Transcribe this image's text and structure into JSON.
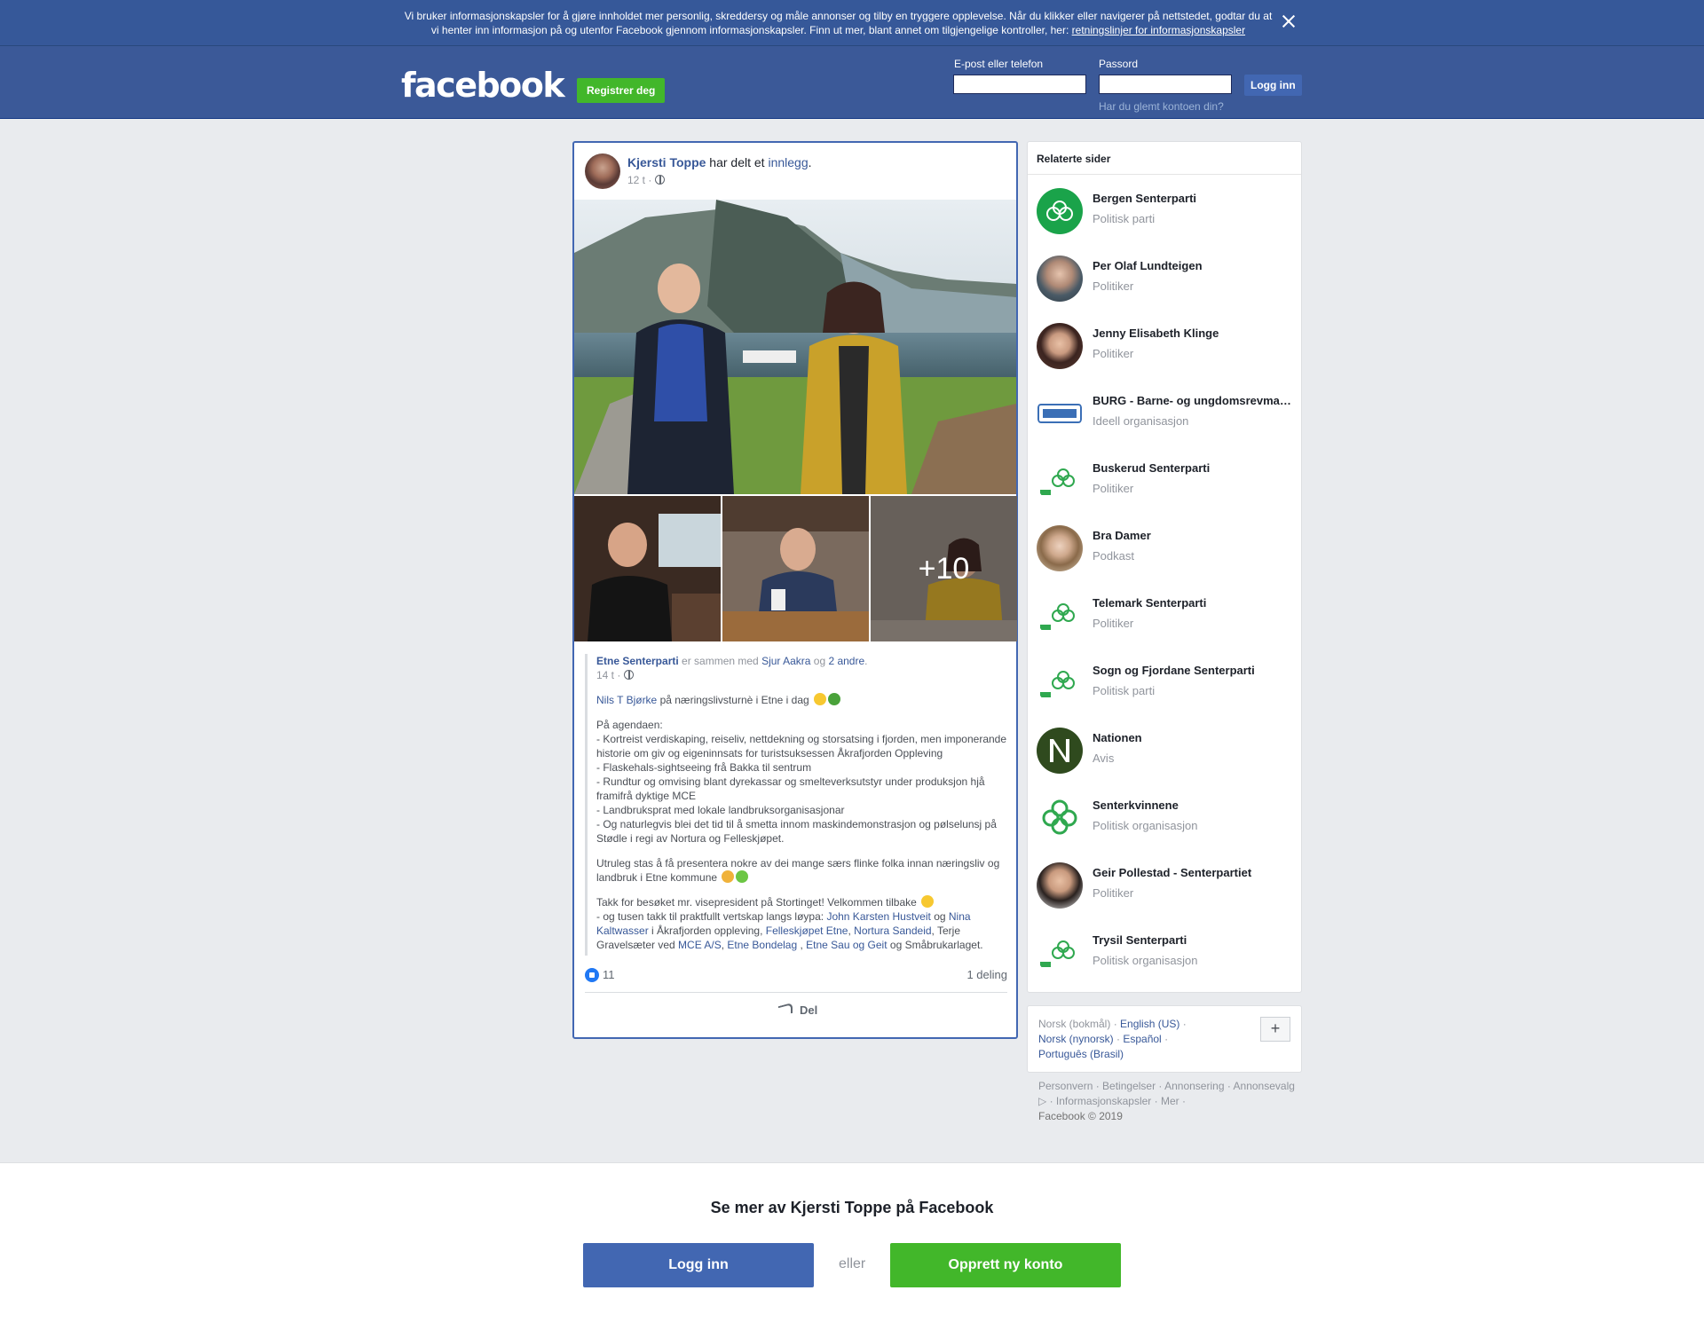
{
  "cookie": {
    "text": "Vi bruker informasjonskapsler for å gjøre innholdet mer personlig, skreddersy og måle annonser og tilby en tryggere opplevelse. Når du klikker eller navigerer på nettstedet, godtar du at vi henter inn informasjon på og utenfor Facebook gjennom informasjonskapsler. Finn ut mer, blant annet om tilgjengelige kontroller, her: ",
    "link": "retningslinjer for informasjonskapsler"
  },
  "header": {
    "logo": "facebook",
    "register": "Registrer deg",
    "email_label": "E-post eller telefon",
    "password_label": "Passord",
    "login": "Logg inn",
    "forgot": "Har du glemt kontoen din?",
    "email_value": "",
    "password_value": ""
  },
  "post": {
    "author": "Kjersti Toppe",
    "shared_text": " har delt et ",
    "post_link": "innlegg",
    "period": ".",
    "time": "12 t · ",
    "photo_more": "+10",
    "shared": {
      "page": "Etne Senterparti",
      "with_text": " er sammen med ",
      "person": "Sjur Aakra",
      "and": " og ",
      "others": "2 andre",
      "dot": ".",
      "time": "14 t · ",
      "p1_link": "Nils T Bjørke",
      "p1_text": " på næringslivsturnè i Etne i dag",
      "p2": "På agendaen:\n- Kortreist verdiskaping, reiseliv, nettdekning og storsatsing i fjorden, men imponerande historie om giv og eigeninnsats for turistsuksessen Åkrafjorden Oppleving\n- Flaskehals-sightseeing frå Bakka til sentrum\n- Rundtur og omvising blant dyrekassar og smelteverksutstyr under produksjon hjå framifrå dyktige MCE\n- Landbruksprat med lokale landbruksorganisasjonar\n- Og naturlegvis blei det tid til å smetta innom maskindemonstrasjon og pølselunsj på Stødle i regi av Nortura og Felleskjøpet.",
      "p3": "Utruleg stas å få presentera nokre av dei mange særs flinke folka innan næringsliv og landbruk i Etne kommune",
      "p4a": "Takk for besøket mr. visepresident på Stortinget! Velkommen tilbake",
      "p4b": "- og tusen takk til praktfullt vertskap langs løypa: ",
      "l1": "John Karsten Hustveit",
      "t1": " og ",
      "l2": "Nina Kaltwasser",
      "t2": " i Åkrafjorden oppleving, ",
      "l3": "Felleskjøpet Etne",
      "t3": ", ",
      "l4": "Nortura Sandeid",
      "t4": ", Terje Gravelsæter ved ",
      "l5": "MCE A/S",
      "t5": ", ",
      "l6": "Etne Bondelag",
      "t6": " , ",
      "l7": "Etne Sau og Geit",
      "t7": " og Småbrukarlaget."
    },
    "likes": "11",
    "shares": "1 deling",
    "share_action": "Del"
  },
  "related": {
    "title": "Relaterte sider",
    "items": [
      {
        "name": "Bergen Senterparti",
        "category": "Politisk parti"
      },
      {
        "name": "Per Olaf Lundteigen",
        "category": "Politiker"
      },
      {
        "name": "Jenny Elisabeth Klinge",
        "category": "Politiker"
      },
      {
        "name": "BURG - Barne- og ungdomsrevmatikergruppen",
        "category": "Ideell organisasjon"
      },
      {
        "name": "Buskerud Senterparti",
        "category": "Politiker"
      },
      {
        "name": "Bra Damer",
        "category": "Podkast"
      },
      {
        "name": "Telemark Senterparti",
        "category": "Politiker"
      },
      {
        "name": "Sogn og Fjordane Senterparti",
        "category": "Politisk parti"
      },
      {
        "name": "Nationen",
        "category": "Avis"
      },
      {
        "name": "Senterkvinnene",
        "category": "Politisk organisasjon"
      },
      {
        "name": "Geir Pollestad - Senterpartiet",
        "category": "Politiker"
      },
      {
        "name": "Trysil Senterparti",
        "category": "Politisk organisasjon"
      }
    ]
  },
  "languages": {
    "current": "Norsk (bokmål)",
    "sep": " · ",
    "en": "English (US)",
    "nn": "Norsk (nynorsk)",
    "es": "Español",
    "pt": "Português (Brasil)",
    "plus": "+"
  },
  "footer": {
    "personvern": "Personvern",
    "betingelser": "Betingelser",
    "annonsering": "Annonsering",
    "annonsevalg": "Annonsevalg",
    "info": "Informasjonskapsler",
    "mer": "Mer",
    "copyright": "Facebook © 2019"
  },
  "bottom": {
    "title": "Se mer av Kjersti Toppe på Facebook",
    "login": "Logg inn",
    "or": "eller",
    "create": "Opprett ny konto"
  }
}
